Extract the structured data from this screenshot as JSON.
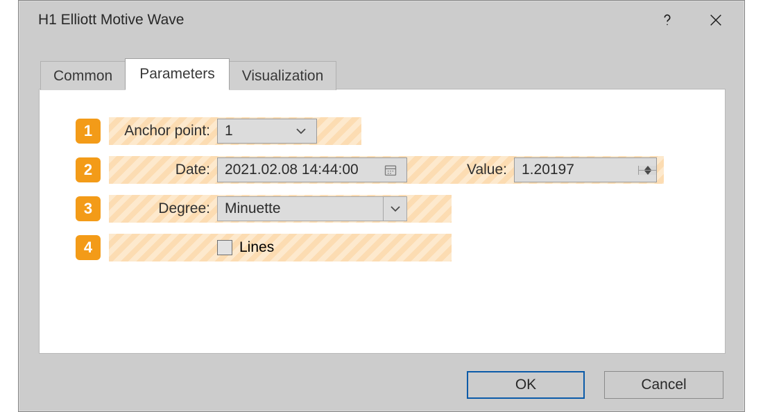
{
  "window": {
    "title": "H1 Elliott Motive Wave"
  },
  "tabs": {
    "common": "Common",
    "parameters": "Parameters",
    "visualization": "Visualization",
    "active": "parameters"
  },
  "markers": {
    "m1": "1",
    "m2": "2",
    "m3": "3",
    "m4": "4"
  },
  "fields": {
    "anchor_label": "Anchor point:",
    "anchor_value": "1",
    "date_label": "Date:",
    "date_value": "2021.02.08 14:44:00",
    "value_label": "Value:",
    "value_value": "1.20197",
    "degree_label": "Degree:",
    "degree_value": "Minuette",
    "lines_label": "Lines",
    "lines_checked": false
  },
  "buttons": {
    "ok": "OK",
    "cancel": "Cancel"
  }
}
